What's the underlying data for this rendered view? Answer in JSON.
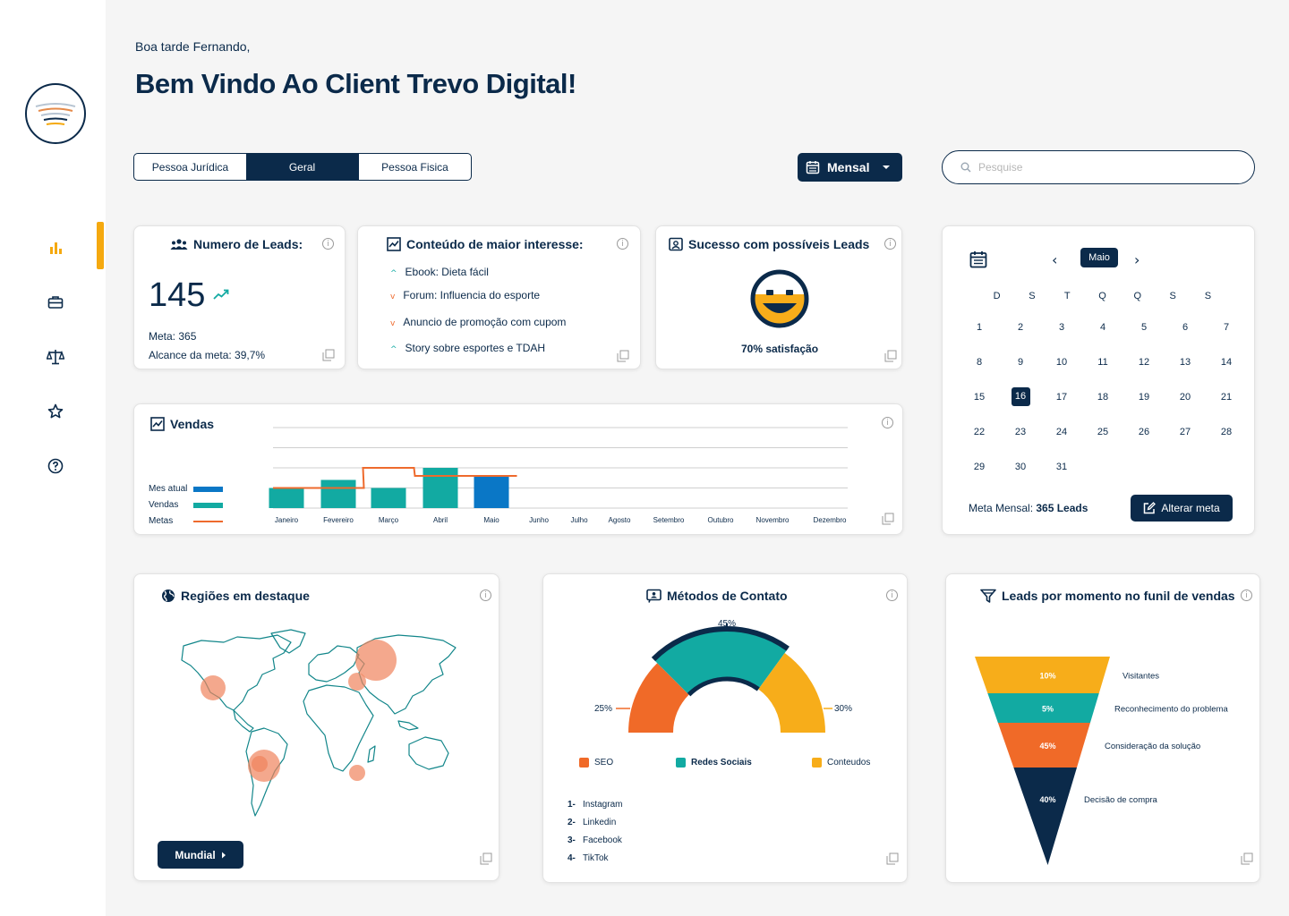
{
  "header": {
    "greeting": "Boa tarde Fernando,",
    "title": "Bem Vindo Ao Client Trevo Digital!"
  },
  "segment": {
    "options": [
      "Pessoa Jurídica",
      "Geral",
      "Pessoa Fisica"
    ],
    "selected": "Geral"
  },
  "period": {
    "label": "Mensal"
  },
  "search": {
    "placeholder": "Pesquise"
  },
  "leads_card": {
    "title": "Numero de Leads:",
    "value": "145",
    "meta": "Meta: 365",
    "alcance": "Alcance da meta: 39,7%"
  },
  "interest_card": {
    "title": "Conteúdo de maior interesse:",
    "items": [
      {
        "label": "Ebook: Dieta fácil",
        "trend": "up"
      },
      {
        "label": "Forum: Influencia do esporte",
        "trend": "down"
      },
      {
        "label": "Anuncio de promoção com cupom",
        "trend": "down"
      },
      {
        "label": "Story sobre esportes e TDAH",
        "trend": "up"
      }
    ]
  },
  "success_card": {
    "title": "Sucesso com possíveis Leads",
    "satisfaction": "70% satisfação"
  },
  "calendar": {
    "month": "Maio",
    "weekdays": [
      "D",
      "S",
      "T",
      "Q",
      "Q",
      "S",
      "S"
    ],
    "weeks": [
      [
        "1",
        "2",
        "3",
        "4",
        "5",
        "6",
        "7"
      ],
      [
        "8",
        "9",
        "10",
        "11",
        "12",
        "13",
        "14"
      ],
      [
        "15",
        "16",
        "17",
        "18",
        "19",
        "20",
        "21"
      ],
      [
        "22",
        "23",
        "24",
        "25",
        "26",
        "27",
        "28"
      ],
      [
        "29",
        "30",
        "31",
        "",
        "",
        "",
        ""
      ]
    ],
    "selected_day": "16",
    "meta_label": "Meta Mensal: ",
    "meta_value": "365 Leads",
    "button": "Alterar meta"
  },
  "sales_card": {
    "title": "Vendas",
    "legend": {
      "mes_atual": "Mes atual",
      "vendas": "Vendas",
      "metas": "Metas"
    }
  },
  "chart_data": [
    {
      "type": "bar",
      "title": "Vendas",
      "categories": [
        "Janeiro",
        "Fevereiro",
        "Março",
        "Abril",
        "Maio",
        "Junho",
        "Julho",
        "Agosto",
        "Setembro",
        "Outubro",
        "Novembro",
        "Dezembro"
      ],
      "series": [
        {
          "name": "Vendas",
          "values": [
            1,
            1.4,
            1,
            2,
            null,
            null,
            null,
            null,
            null,
            null,
            null,
            null
          ]
        },
        {
          "name": "Mes atual",
          "values": [
            null,
            null,
            null,
            null,
            1.6,
            null,
            null,
            null,
            null,
            null,
            null,
            null
          ]
        },
        {
          "name": "Metas",
          "type": "step-line",
          "values": [
            1,
            1,
            2,
            1.6,
            1.6,
            null,
            null,
            null,
            null,
            null,
            null,
            null
          ]
        }
      ],
      "ylim": [
        0,
        4
      ],
      "grid": true,
      "legend_position": "left",
      "colors": {
        "Vendas": "#12aaa2",
        "Mes atual": "#0a77c6",
        "Metas": "#ee6a2d"
      }
    },
    {
      "type": "pie",
      "title": "Métodos de Contato",
      "categories": [
        "SEO",
        "Redes Sociais",
        "Conteudos"
      ],
      "values": [
        25,
        45,
        30
      ],
      "labels": [
        "25%",
        "45%",
        "30%"
      ],
      "colors": [
        "#f06a28",
        "#12aaa2",
        "#f7ad1a"
      ]
    },
    {
      "type": "funnel",
      "title": "Leads por momento no funil de vendas",
      "categories": [
        "Visitantes",
        "Reconhecimento do problema",
        "Consideração da solução",
        "Decisão de compra"
      ],
      "values": [
        10,
        5,
        45,
        40
      ],
      "labels": [
        "10%",
        "5%",
        "45%",
        "40%"
      ],
      "colors": [
        "#f7ad1a",
        "#12aaa2",
        "#f06a28",
        "#0b2a4a"
      ]
    }
  ],
  "regions_card": {
    "title": "Regiões em destaque",
    "button": "Mundial"
  },
  "contact_card": {
    "title": "Métodos de Contato",
    "ranking": [
      {
        "n": "1-",
        "label": "Instagram"
      },
      {
        "n": "2-",
        "label": "Linkedin"
      },
      {
        "n": "3-",
        "label": "Facebook"
      },
      {
        "n": "4-",
        "label": "TikTok"
      }
    ]
  },
  "funnel_card": {
    "title": "Leads por momento no funil de vendas"
  },
  "colors": {
    "navy": "#0b2a4a",
    "accent": "#f5a90f",
    "teal": "#12aaa2",
    "orange": "#f06a28",
    "blue": "#0a77c6"
  }
}
